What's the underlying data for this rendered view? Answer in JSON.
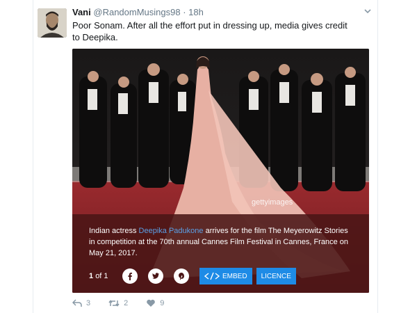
{
  "tweet": {
    "name": "Vani",
    "handle": "@RandomMusings98",
    "separator": "·",
    "time": "18h",
    "text": "Poor Sonam. After all the effort put in dressing up, media gives credit to Deepika."
  },
  "media": {
    "watermark": "gettyimages",
    "caption_before": "Indian actress ",
    "caption_link": "Deepika Padukone",
    "caption_after": " arrives for the film The Meyerowitz Stories in competition at the 70th annual Cannes Film Festival in Cannes, France on May 21, 2017.",
    "counter_current": "1",
    "counter_of": "of 1",
    "embed_label": "EMBED",
    "licence_label": "LICENCE"
  },
  "actions": {
    "replies": "3",
    "retweets": "2",
    "likes": "9"
  },
  "colors": {
    "link": "#5aa0e6",
    "button": "#1e8be6",
    "caption_bg": "#4a1616",
    "muted": "#8899a6"
  }
}
